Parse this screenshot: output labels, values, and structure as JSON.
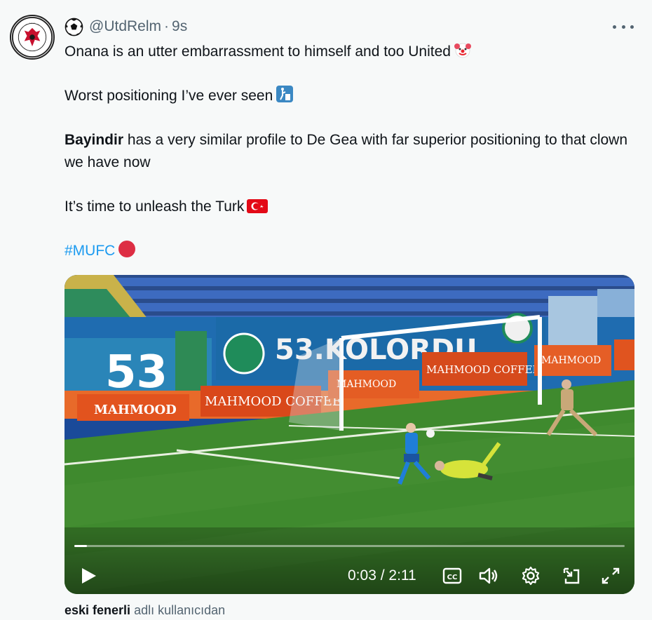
{
  "tweet": {
    "handle": "@UtdRelm",
    "separator": "·",
    "timestamp": "9s",
    "lines": {
      "l1": "Onana is an utter embarrassment to himself and too United",
      "l2": "Worst positioning I’ve ever seen",
      "l3_bold": "Bayindir",
      "l3_rest": " has a very similar profile to De Gea with far superior positioning to that clown we have now",
      "l4": "It’s time to unleash the Turk",
      "hashtag": "#MUFC"
    },
    "emojis": [
      "clown-face",
      "litter-in-bin",
      "turkey-flag",
      "red-circle"
    ]
  },
  "video": {
    "current_time": "0:03",
    "time_separator": " / ",
    "duration": "2:11",
    "progress": 0.023,
    "stadium_text": "53.KOLORDU",
    "banner_text": "MAHMOOD COFFEE",
    "number_text": "53"
  },
  "attribution": {
    "name": "eski fenerli",
    "suffix": "adlı kullanıcıdan"
  },
  "colors": {
    "link": "#1d9bf0",
    "secondary": "#536471",
    "background": "#f7f9f9"
  }
}
